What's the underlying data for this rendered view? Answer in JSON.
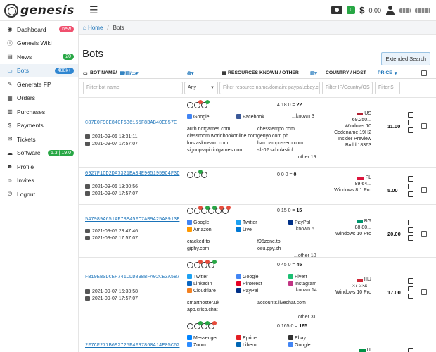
{
  "header": {
    "logo_text": "genesis",
    "cash_badge": "0",
    "balance": "0.00",
    "dollar": "$"
  },
  "sidebar": {
    "items": [
      {
        "label": "Dashboard",
        "icon": "dashboard-icon",
        "glyph": "◉",
        "badge": "new",
        "badge_color": "#f0506e"
      },
      {
        "label": "Genesis Wiki",
        "icon": "info-icon",
        "glyph": "ⓘ",
        "badge": "",
        "badge_color": ""
      },
      {
        "label": "News",
        "icon": "news-icon",
        "glyph": "▤",
        "badge": "20",
        "badge_color": "#28a745"
      },
      {
        "label": "Bots",
        "icon": "laptop-icon",
        "glyph": "▭",
        "badge": "400k+",
        "badge_color": "#2f86d1"
      },
      {
        "label": "Generate FP",
        "icon": "magic-icon",
        "glyph": "✎",
        "badge": "",
        "badge_color": ""
      },
      {
        "label": "Orders",
        "icon": "orders-icon",
        "glyph": "▦",
        "badge": "",
        "badge_color": ""
      },
      {
        "label": "Purchases",
        "icon": "purchases-icon",
        "glyph": "▥",
        "badge": "",
        "badge_color": ""
      },
      {
        "label": "Payments",
        "icon": "payments-icon",
        "glyph": "$",
        "badge": "",
        "badge_color": ""
      },
      {
        "label": "Tickets",
        "icon": "tickets-icon",
        "glyph": "✉",
        "badge": "",
        "badge_color": ""
      },
      {
        "label": "Software",
        "icon": "software-icon",
        "glyph": "☁",
        "badge": "6.3 | 19.0",
        "badge_color": "#28a745"
      },
      {
        "label": "Profile",
        "icon": "profile-icon",
        "glyph": "☻",
        "badge": "",
        "badge_color": ""
      },
      {
        "label": "Invites",
        "icon": "invites-icon",
        "glyph": "☺",
        "badge": "",
        "badge_color": ""
      },
      {
        "label": "Logout",
        "icon": "logout-icon",
        "glyph": "⏻",
        "badge": "",
        "badge_color": ""
      }
    ]
  },
  "breadcrumb": {
    "home": "Home",
    "current": "Bots"
  },
  "page": {
    "title": "Bots",
    "extended_search": "Extended Search"
  },
  "table": {
    "headers": {
      "bot_name": "BOT NAME/",
      "resources": "RESOURCES KNOWN / OTHER",
      "country": "COUNTRY / HOST",
      "price": "PRICE"
    },
    "filters": {
      "bot_name_placeholder": "Filter bot name",
      "any_select": "Any",
      "resource_placeholder": "Filter resource name/domain: paypal,ebay.c",
      "ip_placeholder": "Filter IP/Country/OS",
      "price_placeholder": "Filter $"
    },
    "rows": [
      {
        "id": "C87E0F9CE840F636165F8BAB40E857E",
        "date1": "2021-09-06 18:31:11",
        "date2": "2021-09-07 17:57:07",
        "counts": "4  18  0 = ",
        "total": "22",
        "resources": [
          {
            "name": "Google",
            "color": "#4285f4",
            "col": 0,
            "line": 0
          },
          {
            "name": "Facebook",
            "color": "#3b5998",
            "col": 1,
            "line": 0
          }
        ],
        "known": "...known 3",
        "domains": [
          [
            "auth.riotgames.com",
            "chesstempo.com"
          ],
          [
            "classroom.worldbookonline.com",
            "genyo.com.ph"
          ],
          [
            "lms.asknlearn.com",
            "lsm.campus-erp.com"
          ],
          [
            "signup-api.riotgames.com",
            "slz02.scholasticl..."
          ]
        ],
        "other": "...other 19",
        "country_code": "US",
        "flag_color": "#b22234",
        "country_lines": [
          "69.250...",
          "Windows 10",
          "Codename 19H2",
          "Insider Preview",
          "Build 18363"
        ],
        "price": "11.00"
      },
      {
        "id": "0927F1CD2DA7321EA34E9051959C4F3D",
        "date1": "2021-09-06 19:30:56",
        "date2": "2021-09-07 17:57:07",
        "counts": "0  0  0 = ",
        "total": "0",
        "resources": [],
        "known": "",
        "domains": [],
        "other": "",
        "country_code": "PL",
        "flag_color": "#dc143c",
        "country_lines": [
          "89.64...",
          "Windows 8.1 Pro"
        ],
        "price": "5.00"
      },
      {
        "id": "547989A651AF78E45FC7AB9A25A0913E",
        "date1": "2021-09-05 23:47:46",
        "date2": "2021-09-07 17:57:07",
        "counts": "0  15  0 = ",
        "total": "15",
        "resources": [
          {
            "name": "Google",
            "color": "#4285f4",
            "col": 0,
            "line": 0
          },
          {
            "name": "Twitter",
            "color": "#1da1f2",
            "col": 1,
            "line": 0
          },
          {
            "name": "PayPal",
            "color": "#003087",
            "col": 2,
            "line": 0
          },
          {
            "name": "Amazon",
            "color": "#ff9900",
            "col": 0,
            "line": 1
          },
          {
            "name": "Live",
            "color": "#0078d4",
            "col": 1,
            "line": 1
          }
        ],
        "known": "...known 5",
        "domains": [
          [
            "cracked.to",
            "f95zone.to"
          ],
          [
            "giphy.com",
            "osu.ppy.sh"
          ]
        ],
        "other": "...other 10",
        "country_code": "BG",
        "flag_color": "#00966e",
        "country_lines": [
          "88.80...",
          "Windows 10 Pro"
        ],
        "price": "20.00"
      },
      {
        "id": "FB19EB0DCEF741CDD89BBFA02CE3A5B7",
        "date1": "2021-09-07 16:33:58",
        "date2": "2021-09-07 17:57:07",
        "counts": "0  45  0 = ",
        "total": "45",
        "resources": [
          {
            "name": "Twitter",
            "color": "#1da1f2",
            "col": 0,
            "line": 0
          },
          {
            "name": "Google",
            "color": "#4285f4",
            "col": 1,
            "line": 0
          },
          {
            "name": "Fiverr",
            "color": "#1dbf73",
            "col": 2,
            "line": 0
          },
          {
            "name": "LinkedIn",
            "color": "#0a66c2",
            "col": 0,
            "line": 1
          },
          {
            "name": "Pinterest",
            "color": "#e60023",
            "col": 1,
            "line": 1
          },
          {
            "name": "Instagram",
            "color": "#c13584",
            "col": 2,
            "line": 1
          },
          {
            "name": "Cloudflare",
            "color": "#f38020",
            "col": 0,
            "line": 2
          },
          {
            "name": "PayPal",
            "color": "#003087",
            "col": 1,
            "line": 2
          }
        ],
        "known": "...known 14",
        "domains": [
          [
            "smarthoster.uk",
            "accounts.livechat.com"
          ],
          [
            "app.crisp.chat",
            ""
          ]
        ],
        "other": "...other 31",
        "country_code": "HU",
        "flag_color": "#ce2939",
        "country_lines": [
          "37.234...",
          "Windows 10 Pro"
        ],
        "price": "17.00"
      },
      {
        "id": "2F7CF277B692725F4F97860A14E05C62",
        "date1": "",
        "date2": "",
        "counts": "0  165  0 = ",
        "total": "165",
        "resources": [
          {
            "name": "Messenger",
            "color": "#0084ff",
            "col": 0,
            "line": 0
          },
          {
            "name": "Eprice",
            "color": "#e31e24",
            "col": 1,
            "line": 0
          },
          {
            "name": "Ebay",
            "color": "#333333",
            "col": 2,
            "line": 0
          },
          {
            "name": "Zoom",
            "color": "#2d8cff",
            "col": 0,
            "line": 1
          },
          {
            "name": "Libero",
            "color": "#0066b3",
            "col": 1,
            "line": 1
          },
          {
            "name": "Google",
            "color": "#4285f4",
            "col": 2,
            "line": 1
          }
        ],
        "known": "",
        "domains": [],
        "other": "",
        "country_code": "IT",
        "flag_color": "#009246",
        "country_lines": [],
        "price": ""
      }
    ]
  }
}
